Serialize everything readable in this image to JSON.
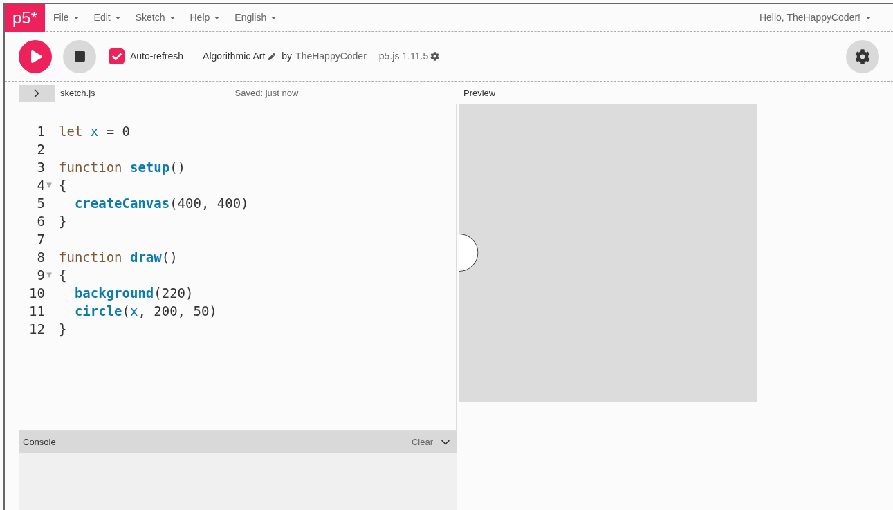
{
  "logo": "p5*",
  "menu": [
    {
      "label": "File"
    },
    {
      "label": "Edit"
    },
    {
      "label": "Sketch"
    },
    {
      "label": "Help"
    },
    {
      "label": "English"
    }
  ],
  "user_menu": "Hello, TheHappyCoder!",
  "toolbar": {
    "auto_refresh": {
      "label": "Auto-refresh",
      "checked": true
    },
    "sketch_name": "Algorithmic Art",
    "by": "by",
    "author": "TheHappyCoder",
    "version": "p5.js 1.11.5"
  },
  "file_bar": {
    "file_name": "sketch.js",
    "status": "Saved: just now",
    "preview_label": "Preview"
  },
  "editor": {
    "lines": [
      {
        "number": "1",
        "tokens": [
          {
            "kind": "keyword",
            "text": "let"
          },
          {
            "kind": "variable",
            "text": " x"
          },
          {
            "kind": "plain",
            "text": " = 0"
          }
        ]
      },
      {
        "number": "2"
      },
      {
        "number": "3",
        "tokens": [
          {
            "kind": "keyword",
            "text": "function"
          },
          {
            "kind": "function",
            "text": " setup"
          },
          {
            "kind": "plain",
            "text": "()"
          }
        ]
      },
      {
        "number": "4",
        "fold_marker": "▼",
        "tokens": [
          {
            "kind": "plain",
            "text": "{"
          }
        ]
      },
      {
        "number": "5",
        "tokens": [
          {
            "kind": "function",
            "text": "  createCanvas"
          },
          {
            "kind": "plain",
            "text": "(400, 400)"
          }
        ]
      },
      {
        "number": "6",
        "tokens": [
          {
            "kind": "plain",
            "text": "}"
          }
        ]
      },
      {
        "number": "7"
      },
      {
        "number": "8",
        "tokens": [
          {
            "kind": "keyword",
            "text": "function"
          },
          {
            "kind": "function",
            "text": " draw"
          },
          {
            "kind": "plain",
            "text": "()"
          }
        ]
      },
      {
        "number": "9",
        "fold_marker": "▼",
        "tokens": [
          {
            "kind": "plain",
            "text": "{"
          }
        ]
      },
      {
        "number": "10",
        "tokens": [
          {
            "kind": "function",
            "text": "  background"
          },
          {
            "kind": "plain",
            "text": "(220)"
          }
        ]
      },
      {
        "number": "11",
        "tokens": [
          {
            "kind": "function",
            "text": "  circle"
          },
          {
            "kind": "plain",
            "text": "("
          },
          {
            "kind": "variable",
            "text": "x"
          },
          {
            "kind": "plain",
            "text": ", 200, 50)"
          }
        ]
      },
      {
        "number": "12",
        "tokens": [
          {
            "kind": "plain",
            "text": "}"
          }
        ]
      }
    ]
  },
  "console": {
    "title": "Console",
    "clear": "Clear"
  }
}
